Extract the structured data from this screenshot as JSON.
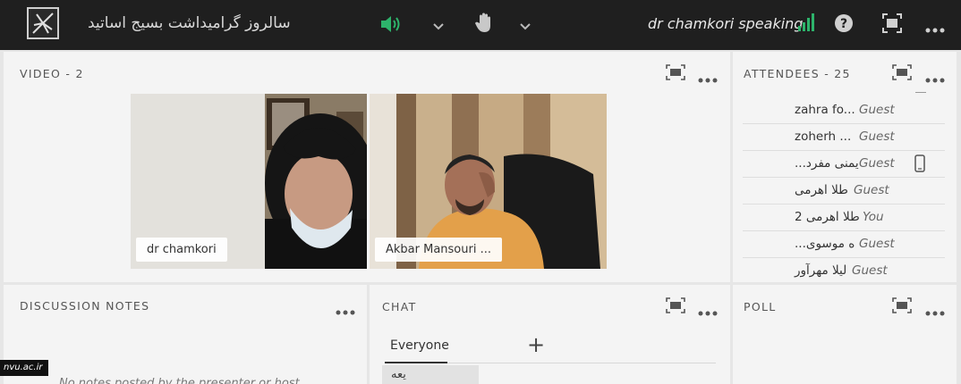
{
  "header": {
    "meeting_title": "سالروز گرامیداشت بسیج اساتید",
    "speaking_status": "dr chamkori speaking"
  },
  "icons": {
    "logo": "app-logo-icon",
    "speaker": "speaker-volume-icon",
    "raise_hand": "raise-hand-icon",
    "help": "help-icon",
    "fullscreen": "fullscreen-icon",
    "more": "more-icon",
    "signal": "signal-strength-icon",
    "mobile": "mobile-device-icon"
  },
  "colors": {
    "speaker_green": "#2db36b",
    "signal_green": "#2db36b",
    "topbar": "#1f1f1f"
  },
  "video_pod": {
    "title": "VIDEO - 2",
    "tiles": [
      {
        "name": "dr chamkori"
      },
      {
        "name": "Akbar Mansouri ..."
      }
    ]
  },
  "attendees_pod": {
    "title": "ATTENDEES - 25",
    "rows": [
      {
        "name": "zahra fo...",
        "role": "Guest"
      },
      {
        "name": "zoherh ...",
        "role": "Guest"
      },
      {
        "name": "...یمنی مفرد",
        "role": "Guest"
      },
      {
        "name": "طلا اهرمی",
        "role": "Guest"
      },
      {
        "name": "طلا اهرمی 2",
        "role": "You"
      },
      {
        "name": "...ه موسوی",
        "role": "Guest"
      },
      {
        "name": "لیلا مهرآور",
        "role": "Guest"
      }
    ]
  },
  "notes_pod": {
    "title": "DISCUSSION NOTES",
    "body": "No notes posted by the presenter or host"
  },
  "chat_pod": {
    "title": "CHAT",
    "tab": "Everyone",
    "add_label": "+",
    "preview": "یعه"
  },
  "poll_pod": {
    "title": "POLL"
  },
  "watermark": "nvu.ac.ir"
}
